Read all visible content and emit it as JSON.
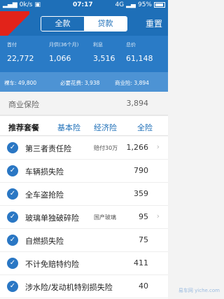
{
  "status": {
    "carrier_speed": "0k/s",
    "time": "07:17",
    "network": "4G",
    "battery": "95%"
  },
  "header": {
    "tabs": [
      {
        "label": "全款",
        "active": true
      },
      {
        "label": "贷款",
        "active": false
      }
    ],
    "reset_label": "重置"
  },
  "summary": {
    "items": [
      {
        "label": "首付",
        "value": "22,772"
      },
      {
        "label": "月供(36个月)",
        "value": "1,066"
      },
      {
        "label": "利息",
        "value": "3,516"
      },
      {
        "label": "总价",
        "value": "61,148"
      }
    ]
  },
  "detail": {
    "car_price": "裸车: 49,800",
    "required_fees": "必要花费: 3,938",
    "commercial": "商业险: 3,894"
  },
  "commercial_insurance": {
    "label": "商业保险",
    "value": "3,894"
  },
  "plans": {
    "title": "推荐套餐",
    "options": [
      "基本险",
      "经济险",
      "全险"
    ]
  },
  "insurance_items": [
    {
      "name": "第三者责任险",
      "sub": "赔付30万",
      "amount": "1,266",
      "has_chevron": true
    },
    {
      "name": "车辆损失险",
      "sub": "",
      "amount": "790",
      "has_chevron": false
    },
    {
      "name": "全车盗抢险",
      "sub": "",
      "amount": "359",
      "has_chevron": false
    },
    {
      "name": "玻璃单独破碎险",
      "sub": "国产玻璃",
      "amount": "95",
      "has_chevron": true
    },
    {
      "name": "自燃损失险",
      "sub": "",
      "amount": "75",
      "has_chevron": false
    },
    {
      "name": "不计免赔特约险",
      "sub": "",
      "amount": "411",
      "has_chevron": false
    },
    {
      "name": "涉水险/发动机特别损失险",
      "sub": "",
      "amount": "40",
      "has_chevron": false
    }
  ],
  "watermark": "易车网 yiche.com",
  "colors": {
    "brand_blue": "#1e6fb8",
    "accent_red": "#e2231a"
  }
}
